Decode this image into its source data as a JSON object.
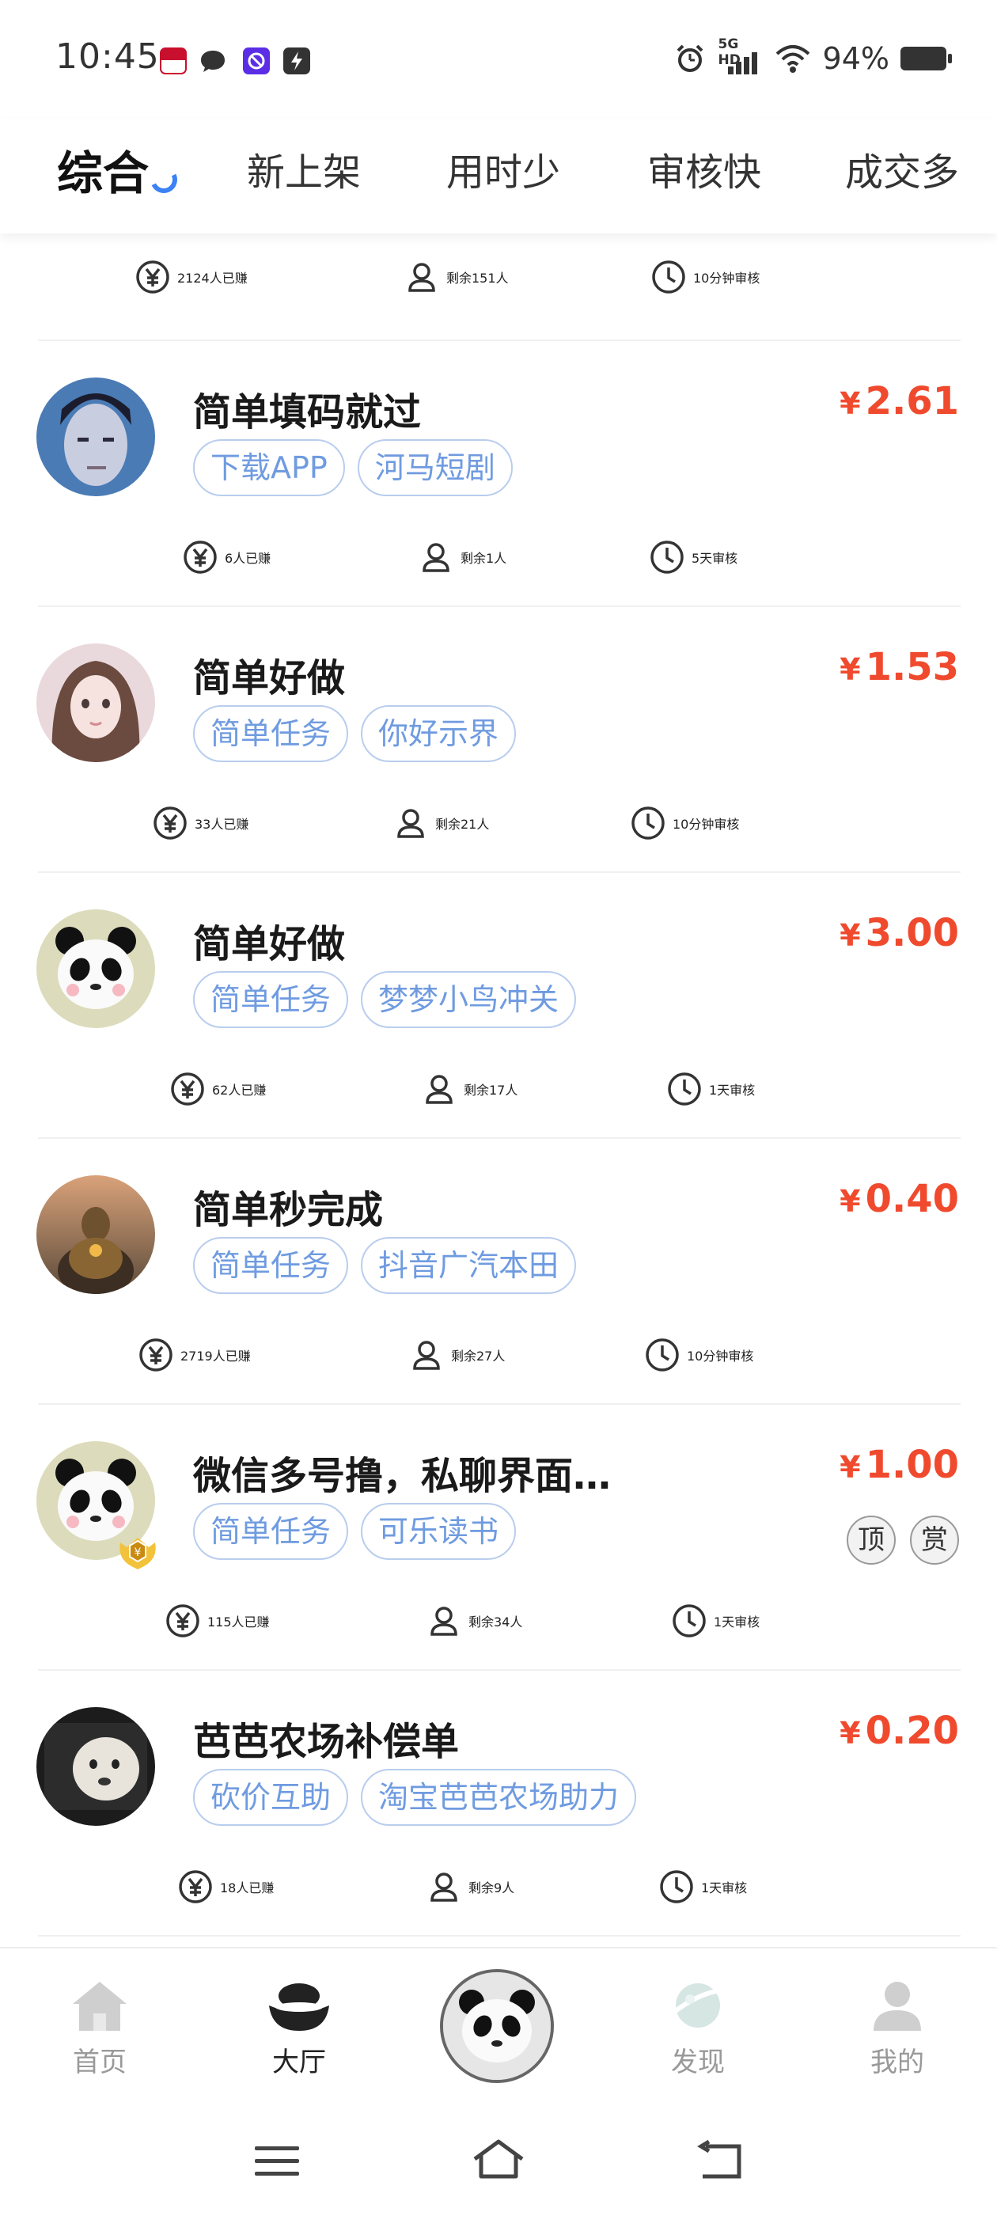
{
  "status_bar": {
    "time": "10:45",
    "network": "5G HD",
    "battery": "94%"
  },
  "tabs": [
    {
      "label": "综合",
      "active": true
    },
    {
      "label": "新上架"
    },
    {
      "label": "用时少"
    },
    {
      "label": "审核快"
    },
    {
      "label": "成交多"
    }
  ],
  "top_partial": {
    "earned": "2124人已赚",
    "remaining": "剩余151人",
    "review": "10分钟审核"
  },
  "items": [
    {
      "title": "简单填码就过",
      "currency": "¥",
      "price": "2.61",
      "tags": [
        "下载APP",
        "河马短剧"
      ],
      "earned": "6人已赚",
      "remaining": "剩余1人",
      "review": "5天审核"
    },
    {
      "title": "简单好做",
      "currency": "¥",
      "price": "1.53",
      "tags": [
        "简单任务",
        "你好示界"
      ],
      "earned": "33人已赚",
      "remaining": "剩余21人",
      "review": "10分钟审核"
    },
    {
      "title": "简单好做",
      "currency": "¥",
      "price": "3.00",
      "tags": [
        "简单任务",
        "梦梦小鸟冲关"
      ],
      "earned": "62人已赚",
      "remaining": "剩余17人",
      "review": "1天审核"
    },
    {
      "title": "简单秒完成",
      "currency": "¥",
      "price": "0.40",
      "tags": [
        "简单任务",
        "抖音广汽本田"
      ],
      "earned": "2719人已赚",
      "remaining": "剩余27人",
      "review": "10分钟审核"
    },
    {
      "title": "微信多号撸，私聊界面…",
      "currency": "¥",
      "price": "1.00",
      "tags": [
        "简单任务",
        "可乐读书"
      ],
      "badges": [
        "顶",
        "赏"
      ],
      "earned": "115人已赚",
      "remaining": "剩余34人",
      "review": "1天审核"
    },
    {
      "title": "芭芭农场补偿单",
      "currency": "¥",
      "price": "0.20",
      "tags": [
        "砍价互助",
        "淘宝芭芭农场助力"
      ],
      "earned": "18人已赚",
      "remaining": "剩余9人",
      "review": "1天审核"
    }
  ],
  "bottom_nav": [
    {
      "label": "首页",
      "icon": "home-icon"
    },
    {
      "label": "大厅",
      "icon": "ingot-icon",
      "active": true
    },
    {
      "label": "",
      "icon": "panda-icon"
    },
    {
      "label": "发现",
      "icon": "planet-icon"
    },
    {
      "label": "我的",
      "icon": "user-icon"
    }
  ],
  "colors": {
    "accent_blue": "#3b82f6",
    "price_red": "#f04a2e",
    "tag_text": "#6f9be0",
    "tag_border": "#b9cdee"
  }
}
